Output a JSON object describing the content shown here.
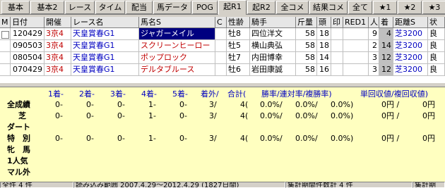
{
  "tabs": [
    "基本",
    "基本2",
    "レース",
    "タイム",
    "配当",
    "馬データ",
    "POG",
    "起R1",
    "起R2",
    "全コメ",
    "結果コメ",
    "全て",
    "★1",
    "★2",
    "★3"
  ],
  "active_tab": "起R1",
  "columns": [
    "M",
    "日付",
    "開催",
    "レース名",
    "馬名S",
    "C",
    "性齢",
    "騎手",
    "斤量",
    "頭",
    "印",
    "RED1",
    "人",
    "着",
    "距離S",
    "状"
  ],
  "rows": [
    {
      "date": "120429",
      "place": "3京4",
      "race": "天皇賞春G1",
      "horse": "ジャガーメイル",
      "sex": "牡8",
      "jockey": "四位洋文",
      "weight": "58",
      "heads": "18",
      "pop": "9",
      "rank": "4",
      "dist": "芝3200",
      "cond": "良"
    },
    {
      "date": "090503",
      "place": "3京4",
      "race": "天皇賞春G1",
      "horse": "スクリーンヒーロー",
      "sex": "牡5",
      "jockey": "横山典弘",
      "weight": "58",
      "heads": "18",
      "pop": "2",
      "rank": "14",
      "dist": "芝3200",
      "cond": "良"
    },
    {
      "date": "080504",
      "place": "3京4",
      "race": "天皇賞春G1",
      "horse": "ポップロック",
      "sex": "牡7",
      "jockey": "内田博幸",
      "weight": "58",
      "heads": "14",
      "pop": "3",
      "rank": "12",
      "dist": "芝3200",
      "cond": "良"
    },
    {
      "date": "070429",
      "place": "3京4",
      "race": "天皇賞春G1",
      "horse": "デルタブルース",
      "sex": "牡6",
      "jockey": "岩田康誠",
      "weight": "58",
      "heads": "16",
      "pop": "3",
      "rank": "12",
      "dist": "芝3200",
      "cond": "良"
    }
  ],
  "stats_header": {
    "h1": "1着-",
    "h2": "2着-",
    "h3": "3着-",
    "h4": "4着-",
    "h5": "5着-",
    "hout": "着外/",
    "htotal": "合計(",
    "hrate": "勝率/連対率/複勝率)",
    "hret": "単回収値/複回収値)"
  },
  "stats_rows": [
    {
      "label": "全成績",
      "v1": "0-",
      "v2": "0-",
      "v3": "0-",
      "v4": "1-",
      "v5": "0-",
      "vout": "3/",
      "vtotal": "4(",
      "r1": "0.0%/",
      "r2": "0.0%/",
      "r3": "0.0%)",
      "ret1": "0円 /",
      "ret2": "0円"
    },
    {
      "label": "芝",
      "v1": "0-",
      "v2": "0-",
      "v3": "0-",
      "v4": "1-",
      "v5": "0-",
      "vout": "3/",
      "vtotal": "4(",
      "r1": "0.0%/",
      "r2": "0.0%/",
      "r3": "0.0%)",
      "ret1": "0円 /",
      "ret2": "0円"
    },
    {
      "label": "ダート",
      "v1": "",
      "v2": "",
      "v3": "",
      "v4": "",
      "v5": "",
      "vout": "",
      "vtotal": "",
      "r1": "",
      "r2": "",
      "r3": "",
      "ret1": "",
      "ret2": ""
    },
    {
      "label": "特　別",
      "v1": "0-",
      "v2": "0-",
      "v3": "0-",
      "v4": "1-",
      "v5": "0-",
      "vout": "3/",
      "vtotal": "4(",
      "r1": "0.0%/",
      "r2": "0.0%/",
      "r3": "0.0%)",
      "ret1": "0円 /",
      "ret2": "0円"
    },
    {
      "label": "牝　馬",
      "v1": "",
      "v2": "",
      "v3": "",
      "v4": "",
      "v5": "",
      "vout": "",
      "vtotal": "",
      "r1": "",
      "r2": "",
      "r3": "",
      "ret1": "",
      "ret2": ""
    },
    {
      "label": "1人気",
      "v1": "",
      "v2": "",
      "v3": "",
      "v4": "",
      "v5": "",
      "vout": "",
      "vtotal": "",
      "r1": "",
      "r2": "",
      "r3": "",
      "ret1": "",
      "ret2": ""
    },
    {
      "label": "マル外",
      "v1": "",
      "v2": "",
      "v3": "",
      "v4": "",
      "v5": "",
      "vout": "",
      "vtotal": "",
      "r1": "",
      "r2": "",
      "r3": "",
      "ret1": "",
      "ret2": ""
    }
  ],
  "status": {
    "count": "全件 4 件",
    "range": "読み込み範囲 2007.4.29～2012.4.29 (1827日間)",
    "period": "集計期間件数計 4 件",
    "extra": "集計期"
  },
  "colors": {
    "stats_bg": "#ffffc0",
    "label_blue": "#0000c0",
    "selection": "#000080",
    "header_bg": "#e6e6e6"
  }
}
